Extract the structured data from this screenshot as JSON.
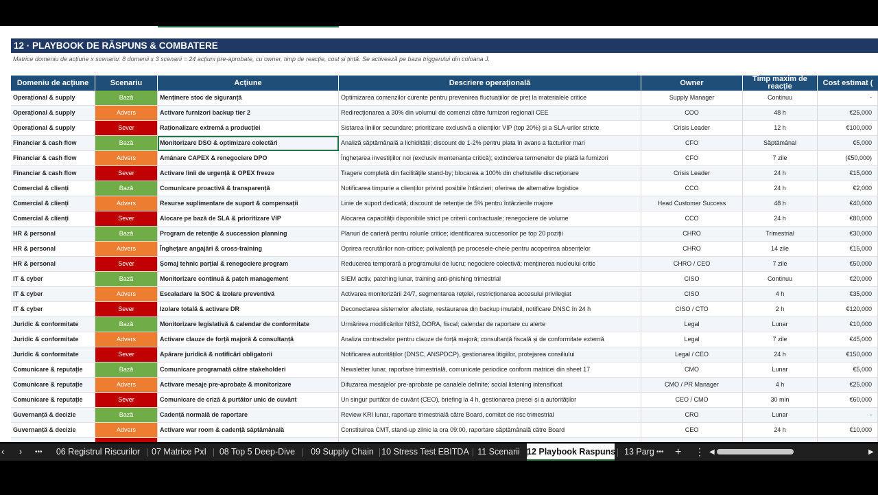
{
  "sheet": {
    "title": "12 · PLAYBOOK DE RĂSPUNS & COMBATERE",
    "subtitle": "Matrice domeniu de acțiune x scenariu: 8 domenii x 3 scenarii = 24 acțiuni pre-aprobate, cu owner, timp de reacție, cost și țintă. Se activează pe baza triggerului din coloana J."
  },
  "colors": {
    "baza": "#70ad47",
    "advers": "#ed7d31",
    "sever": "#c00000",
    "header": "#1f4e79",
    "title": "#1f3864"
  },
  "headers": [
    "Domeniu de acțiune",
    "Scenariu",
    "Acțiune",
    "Descriere operațională",
    "Owner",
    "Timp maxim de reacție",
    "Cost estimat ("
  ],
  "rows": [
    {
      "domeniu": "Operațional & supply",
      "scenariu": "Bază",
      "actiune": "Menținere stoc de siguranță",
      "descriere": "Optimizarea comenzilor curente pentru prevenirea fluctuațiilor de preț la materialele critice",
      "owner": "Supply Manager",
      "timp": "Continuu",
      "cost": "-"
    },
    {
      "domeniu": "Operațional & supply",
      "scenariu": "Advers",
      "actiune": "Activare furnizori backup tier 2",
      "descriere": "Redirecționarea a 30% din volumul de comenzi către furnizori regionali CEE",
      "owner": "COO",
      "timp": "48 h",
      "cost": "€25,000"
    },
    {
      "domeniu": "Operațional & supply",
      "scenariu": "Sever",
      "actiune": "Raționalizare extremă a producției",
      "descriere": "Sistarea liniilor secundare; prioritizare exclusivă a clienților VIP (top 20%) și a SLA-urilor stricte",
      "owner": "Crisis Leader",
      "timp": "12 h",
      "cost": "€100,000"
    },
    {
      "domeniu": "Financiar & cash flow",
      "scenariu": "Bază",
      "actiune": "Monitorizare DSO & optimizare colectări",
      "descriere": "Analiză săptămânală a lichidității; discount de 1-2% pentru plata în avans a facturilor mari",
      "owner": "CFO",
      "timp": "Săptămânal",
      "cost": "€5,000"
    },
    {
      "domeniu": "Financiar & cash flow",
      "scenariu": "Advers",
      "actiune": "Amânare CAPEX & renegociere DPO",
      "descriere": "Înghețarea investițiilor noi (exclusiv mentenanța critică); extinderea termenelor de plată la furnizori",
      "owner": "CFO",
      "timp": "7 zile",
      "cost": "(€50,000)"
    },
    {
      "domeniu": "Financiar & cash flow",
      "scenariu": "Sever",
      "actiune": "Activare linii de urgență & OPEX freeze",
      "descriere": "Tragere completă din facilitățile stand-by; blocarea a 100% din cheltuielile discreționare",
      "owner": "Crisis Leader",
      "timp": "24 h",
      "cost": "€15,000"
    },
    {
      "domeniu": "Comercial & clienți",
      "scenariu": "Bază",
      "actiune": "Comunicare proactivă & transparență",
      "descriere": "Notificarea timpurie a clienților privind posibile întârzieri; oferirea de alternative logistice",
      "owner": "CCO",
      "timp": "24 h",
      "cost": "€2,000"
    },
    {
      "domeniu": "Comercial & clienți",
      "scenariu": "Advers",
      "actiune": "Resurse suplimentare de suport & compensații",
      "descriere": "Linie de suport dedicată; discount de retenție de 5% pentru întârzierile majore",
      "owner": "Head Customer Success",
      "timp": "48 h",
      "cost": "€40,000"
    },
    {
      "domeniu": "Comercial & clienți",
      "scenariu": "Sever",
      "actiune": "Alocare pe bază de SLA & prioritizare VIP",
      "descriere": "Alocarea capacității disponibile strict pe criterii contractuale; renegociere de volume",
      "owner": "CCO",
      "timp": "24 h",
      "cost": "€80,000"
    },
    {
      "domeniu": "HR & personal",
      "scenariu": "Bază",
      "actiune": "Program de retenție & succession planning",
      "descriere": "Planuri de carieră pentru rolurile critice; identificarea succesorilor pe top 20 poziții",
      "owner": "CHRO",
      "timp": "Trimestrial",
      "cost": "€30,000"
    },
    {
      "domeniu": "HR & personal",
      "scenariu": "Advers",
      "actiune": "Înghețare angajări & cross-training",
      "descriere": "Oprirea recrutărilor non-critice; polivalență pe procesele-cheie pentru acoperirea absențelor",
      "owner": "CHRO",
      "timp": "14 zile",
      "cost": "€15,000"
    },
    {
      "domeniu": "HR & personal",
      "scenariu": "Sever",
      "actiune": "Șomaj tehnic parțial & renegociere program",
      "descriere": "Reducerea temporară a programului de lucru; negociere colectivă; menținerea nucleului critic",
      "owner": "CHRO / CEO",
      "timp": "7 zile",
      "cost": "€50,000"
    },
    {
      "domeniu": "IT & cyber",
      "scenariu": "Bază",
      "actiune": "Monitorizare continuă & patch management",
      "descriere": "SIEM activ, patching lunar, training anti-phishing trimestrial",
      "owner": "CISO",
      "timp": "Continuu",
      "cost": "€20,000"
    },
    {
      "domeniu": "IT & cyber",
      "scenariu": "Advers",
      "actiune": "Escaladare la SOC & izolare preventivă",
      "descriere": "Activarea monitorizării 24/7, segmentarea rețelei, restricționarea accesului privilegiat",
      "owner": "CISO",
      "timp": "4 h",
      "cost": "€35,000"
    },
    {
      "domeniu": "IT & cyber",
      "scenariu": "Sever",
      "actiune": "Izolare totală & activare DR",
      "descriere": "Deconectarea sistemelor afectate, restaurarea din backup imutabil, notificare DNSC în 24 h",
      "owner": "CISO / CTO",
      "timp": "2 h",
      "cost": "€120,000"
    },
    {
      "domeniu": "Juridic & conformitate",
      "scenariu": "Bază",
      "actiune": "Monitorizare legislativă & calendar de conformitate",
      "descriere": "Urmărirea modificărilor NIS2, DORA, fiscal; calendar de raportare cu alerte",
      "owner": "Legal",
      "timp": "Lunar",
      "cost": "€10,000"
    },
    {
      "domeniu": "Juridic & conformitate",
      "scenariu": "Advers",
      "actiune": "Activare clauze de forță majoră & consultanță",
      "descriere": "Analiza contractelor pentru clauze de forță majoră; consultanță fiscală și de conformitate externă",
      "owner": "Legal",
      "timp": "7 zile",
      "cost": "€45,000"
    },
    {
      "domeniu": "Juridic & conformitate",
      "scenariu": "Sever",
      "actiune": "Apărare juridică & notificări obligatorii",
      "descriere": "Notificarea autorităților (DNSC, ANSPDCP), gestionarea litigiilor, protejarea consiliului",
      "owner": "Legal / CEO",
      "timp": "24 h",
      "cost": "€150,000"
    },
    {
      "domeniu": "Comunicare & reputație",
      "scenariu": "Bază",
      "actiune": "Comunicare programată către stakeholderi",
      "descriere": "Newsletter lunar, raportare trimestrială, comunicate periodice conform matricei din sheet 17",
      "owner": "CMO",
      "timp": "Lunar",
      "cost": "€5,000"
    },
    {
      "domeniu": "Comunicare & reputație",
      "scenariu": "Advers",
      "actiune": "Activare mesaje pre-aprobate & monitorizare",
      "descriere": "Difuzarea mesajelor pre-aprobate pe canalele definite; social listening intensificat",
      "owner": "CMO / PR Manager",
      "timp": "4 h",
      "cost": "€25,000"
    },
    {
      "domeniu": "Comunicare & reputație",
      "scenariu": "Sever",
      "actiune": "Comunicare de criză & purtător unic de cuvânt",
      "descriere": "Un singur purtător de cuvânt (CEO), briefing la 4 h, gestionarea presei și a autorităților",
      "owner": "CEO / CMO",
      "timp": "30 min",
      "cost": "€60,000"
    },
    {
      "domeniu": "Guvernanță & decizie",
      "scenariu": "Bază",
      "actiune": "Cadență normală de raportare",
      "descriere": "Review KRI lunar, raportare trimestrială către Board, comitet de risc trimestrial",
      "owner": "CRO",
      "timp": "Lunar",
      "cost": "-"
    },
    {
      "domeniu": "Guvernanță & decizie",
      "scenariu": "Advers",
      "actiune": "Activare war room & cadență săptămânală",
      "descriere": "Constituirea CMT, stand-up zilnic la ora 09:00, raportare săptămânală către Board",
      "owner": "CEO",
      "timp": "24 h",
      "cost": "€10,000"
    },
    {
      "domeniu": "",
      "scenariu": "Sever",
      "actiune": "",
      "descriere": "",
      "owner": "",
      "timp": "",
      "cost": ""
    }
  ],
  "tabs": [
    "06 Registrul Riscurilor",
    "07 Matrice PxI",
    "08 Top 5 Deep-Dive",
    "09 Supply Chain",
    "10 Stress Test EBITDA",
    "11 Scenarii",
    "12 Playbook Raspuns",
    "13 Parg"
  ],
  "active_tab": "12 Playbook Raspuns",
  "nav": {
    "prev": "‹",
    "next": "›",
    "more": "•••",
    "add": "+",
    "menu": "⋮"
  }
}
